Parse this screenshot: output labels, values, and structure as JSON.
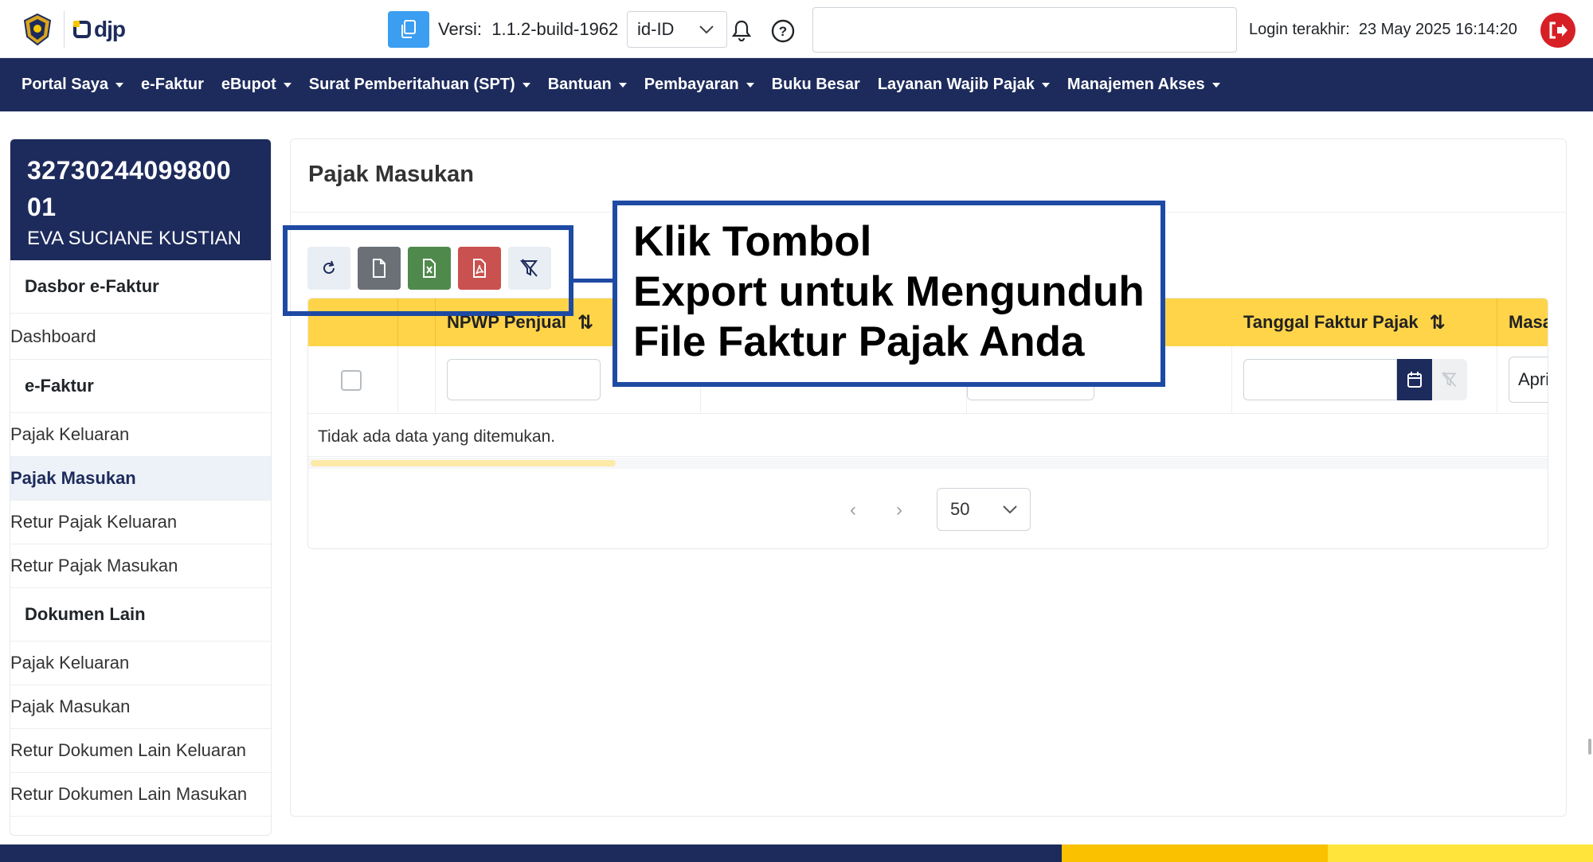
{
  "header": {
    "brand": "djp",
    "version_label": "Versi:",
    "version_value": "1.1.2-build-1962",
    "language": "id-ID",
    "last_login_label": "Login terakhir:",
    "last_login_value": "23 May 2025 16:14:20"
  },
  "nav": {
    "items": [
      {
        "label": "Portal Saya",
        "dropdown": true
      },
      {
        "label": "e-Faktur",
        "dropdown": false
      },
      {
        "label": "eBupot",
        "dropdown": true
      },
      {
        "label": "Surat Pemberitahuan (SPT)",
        "dropdown": true
      },
      {
        "label": "Bantuan",
        "dropdown": true
      },
      {
        "label": "Pembayaran",
        "dropdown": true
      },
      {
        "label": "Buku Besar",
        "dropdown": false
      },
      {
        "label": "Layanan Wajib Pajak",
        "dropdown": true
      },
      {
        "label": "Manajemen Akses",
        "dropdown": true
      }
    ]
  },
  "sidebar": {
    "npwp_line1": "32730244099800",
    "npwp_line2": "01",
    "name": "EVA SUCIANE KUSTIAN",
    "sections": [
      {
        "heading": "Dasbor e-Faktur",
        "items": [
          {
            "label": "Dashboard",
            "active": false
          }
        ]
      },
      {
        "heading": "e-Faktur",
        "items": [
          {
            "label": "Pajak Keluaran",
            "active": false
          },
          {
            "label": "Pajak Masukan",
            "active": true
          },
          {
            "label": "Retur Pajak Keluaran",
            "active": false
          },
          {
            "label": "Retur Pajak Masukan",
            "active": false
          }
        ]
      },
      {
        "heading": "Dokumen Lain",
        "items": [
          {
            "label": "Pajak Keluaran",
            "active": false
          },
          {
            "label": "Pajak Masukan",
            "active": false
          },
          {
            "label": "Retur Dokumen Lain Keluaran",
            "active": false
          },
          {
            "label": "Retur Dokumen Lain Masukan",
            "active": false
          }
        ]
      }
    ]
  },
  "main": {
    "title": "Pajak Masukan",
    "toolbar": {
      "icons": [
        "refresh-icon",
        "file-icon",
        "excel-icon",
        "pdf-icon",
        "filter-clear-icon"
      ],
      "colors": {
        "refresh": "#e9eef4",
        "file": "#6b7077",
        "excel": "#4f8a4c",
        "pdf": "#c9514f",
        "filter": "#e9eef4"
      }
    },
    "callout": {
      "lines": [
        "Klik Tombol",
        "Export untuk Mengunduh",
        "File Faktur Pajak Anda"
      ]
    },
    "table": {
      "columns": [
        {
          "label": "",
          "sortable": false
        },
        {
          "label": "",
          "sortable": false
        },
        {
          "label": "NPWP Penjual",
          "sortable": true
        },
        {
          "label": "",
          "sortable": false
        },
        {
          "label": "",
          "sortable": true
        },
        {
          "label": "Tanggal Faktur Pajak",
          "sortable": true
        },
        {
          "label": "Masa",
          "sortable": false
        }
      ],
      "masa_filter_value": "Apri",
      "empty_message": "Tidak ada data yang ditemukan."
    },
    "pagination": {
      "per_page": "50"
    }
  },
  "theme": {
    "navy": "#1d2b5c",
    "header_yellow": "#ffd449",
    "callout_border": "#1e4aa3",
    "logout_red": "#d71f26",
    "accent_blue": "#3b9ef0"
  }
}
